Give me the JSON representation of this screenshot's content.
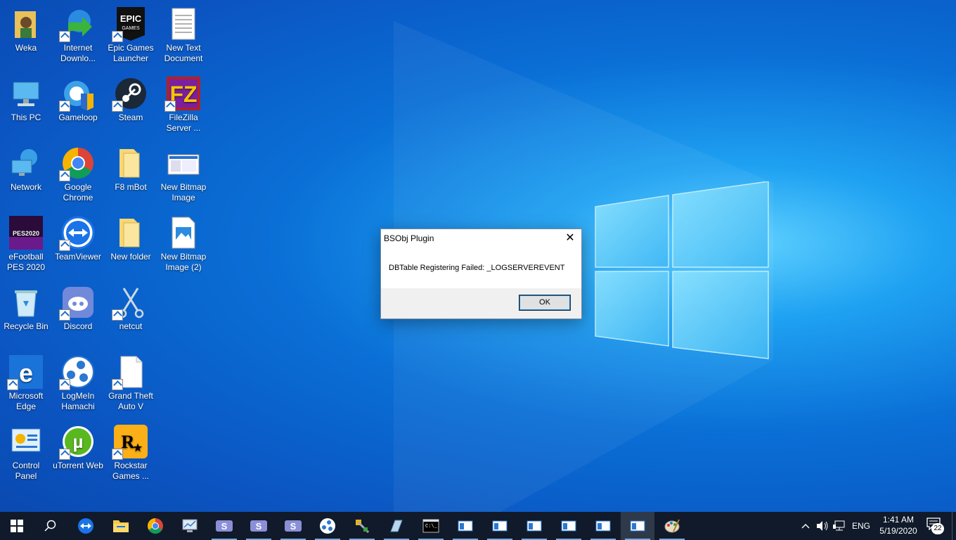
{
  "desktop": {
    "icons": [
      {
        "label": "Weka"
      },
      {
        "label": "Internet Downlo..."
      },
      {
        "label": "Epic Games Launcher"
      },
      {
        "label": "New Text Document"
      },
      {
        "label": "This PC"
      },
      {
        "label": "Gameloop"
      },
      {
        "label": "Steam"
      },
      {
        "label": "FileZilla Server ..."
      },
      {
        "label": "Network"
      },
      {
        "label": "Google Chrome"
      },
      {
        "label": "F8 mBot"
      },
      {
        "label": "New Bitmap Image"
      },
      {
        "label": "eFootball PES 2020"
      },
      {
        "label": "TeamViewer"
      },
      {
        "label": "New folder"
      },
      {
        "label": "New Bitmap Image (2)"
      },
      {
        "label": "Recycle Bin"
      },
      {
        "label": "Discord"
      },
      {
        "label": "netcut"
      },
      {
        "label": "Microsoft Edge"
      },
      {
        "label": "LogMeIn Hamachi"
      },
      {
        "label": "Grand Theft Auto V"
      },
      {
        "label": "Control Panel"
      },
      {
        "label": "uTorrent Web"
      },
      {
        "label": "Rockstar Games ..."
      }
    ]
  },
  "dialog": {
    "title": "BSObj Plugin",
    "close_glyph": "✕",
    "message": "DBTable Registering Failed: _LOGSERVEREVENT",
    "ok_label": "OK"
  },
  "taskbar": {
    "language": "ENG",
    "time": "1:41 AM",
    "date": "5/19/2020",
    "notification_count": "22"
  },
  "colors": {
    "taskbar_bg": "#101a2a",
    "accent": "#0078d7"
  }
}
